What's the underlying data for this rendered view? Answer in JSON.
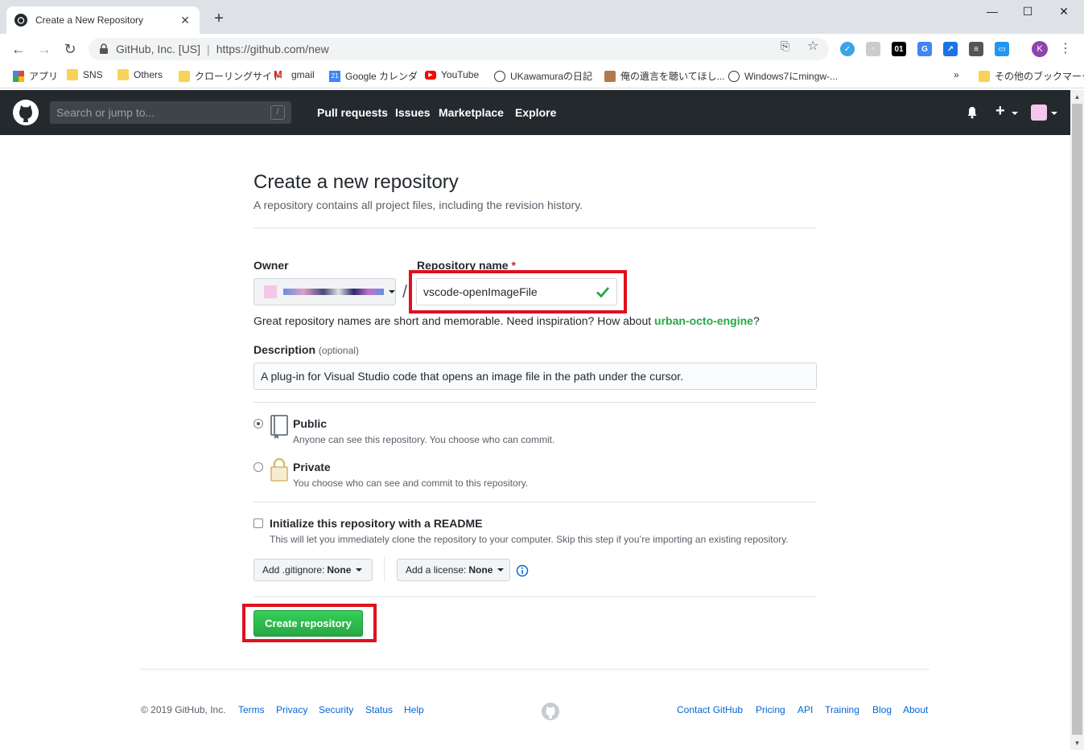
{
  "browser": {
    "tab_title": "Create a New Repository",
    "tab_close": "✕",
    "new_tab": "+",
    "window_minimize": "—",
    "window_maximize": "☐",
    "window_close": "✕",
    "address_site": "GitHub, Inc. [US]",
    "address_url": "https://github.com/new",
    "profile_initial": "K",
    "bookmarks_overflow": "»",
    "bookmarks": [
      {
        "label": "アプリ",
        "icon": "apps-grid-icon"
      },
      {
        "label": "SNS",
        "icon": "folder-icon"
      },
      {
        "label": "Others",
        "icon": "folder-icon"
      },
      {
        "label": "クローリングサイト",
        "icon": "folder-icon"
      },
      {
        "label": "gmail",
        "icon": "gmail-icon"
      },
      {
        "label": "Google カレンダ",
        "icon": "calendar-icon"
      },
      {
        "label": "YouTube",
        "icon": "youtube-icon"
      },
      {
        "label": "UKawamuraの日記",
        "icon": "site-icon"
      },
      {
        "label": "俺の遺言を聴いてほし...",
        "icon": "site-icon"
      },
      {
        "label": "Windows7にmingw-...",
        "icon": "site-icon"
      },
      {
        "label": "その他のブックマーク",
        "icon": "folder-icon"
      }
    ]
  },
  "github_header": {
    "search_placeholder": "Search or jump to...",
    "search_shortcut": "/",
    "nav": [
      "Pull requests",
      "Issues",
      "Marketplace",
      "Explore"
    ],
    "plus": "+"
  },
  "form": {
    "title": "Create a new repository",
    "subtitle": "A repository contains all project files, including the revision history.",
    "owner_label": "Owner",
    "repo_label": "Repository name",
    "required_mark": "*",
    "slash": "/",
    "repo_name": "vscode-openImageFile",
    "hint_prefix": "Great repository names are short and memorable. Need inspiration? How about ",
    "hint_suggestion": "urban-octo-engine",
    "hint_suffix": "?",
    "desc_label": "Description",
    "desc_optional": "(optional)",
    "desc_value": "A plug-in for Visual Studio code that opens an image file in the path under the cursor.",
    "public_title": "Public",
    "public_desc": "Anyone can see this repository. You choose who can commit.",
    "private_title": "Private",
    "private_desc": "You choose who can see and commit to this repository.",
    "readme_title": "Initialize this repository with a README",
    "readme_desc": "This will let you immediately clone the repository to your computer. Skip this step if you’re importing an existing repository.",
    "gitignore_label": "Add .gitignore:",
    "gitignore_value": "None",
    "license_label": "Add a license:",
    "license_value": "None",
    "create_button": "Create repository"
  },
  "footer": {
    "copyright": "© 2019 GitHub, Inc.",
    "left_links": [
      "Terms",
      "Privacy",
      "Security",
      "Status",
      "Help"
    ],
    "right_links": [
      "Contact GitHub",
      "Pricing",
      "API",
      "Training",
      "Blog",
      "About"
    ]
  },
  "colors": {
    "github_dark": "#24292e",
    "primary_green": "#28a745",
    "link_blue": "#0366d6",
    "highlight_red": "#e0101e"
  }
}
